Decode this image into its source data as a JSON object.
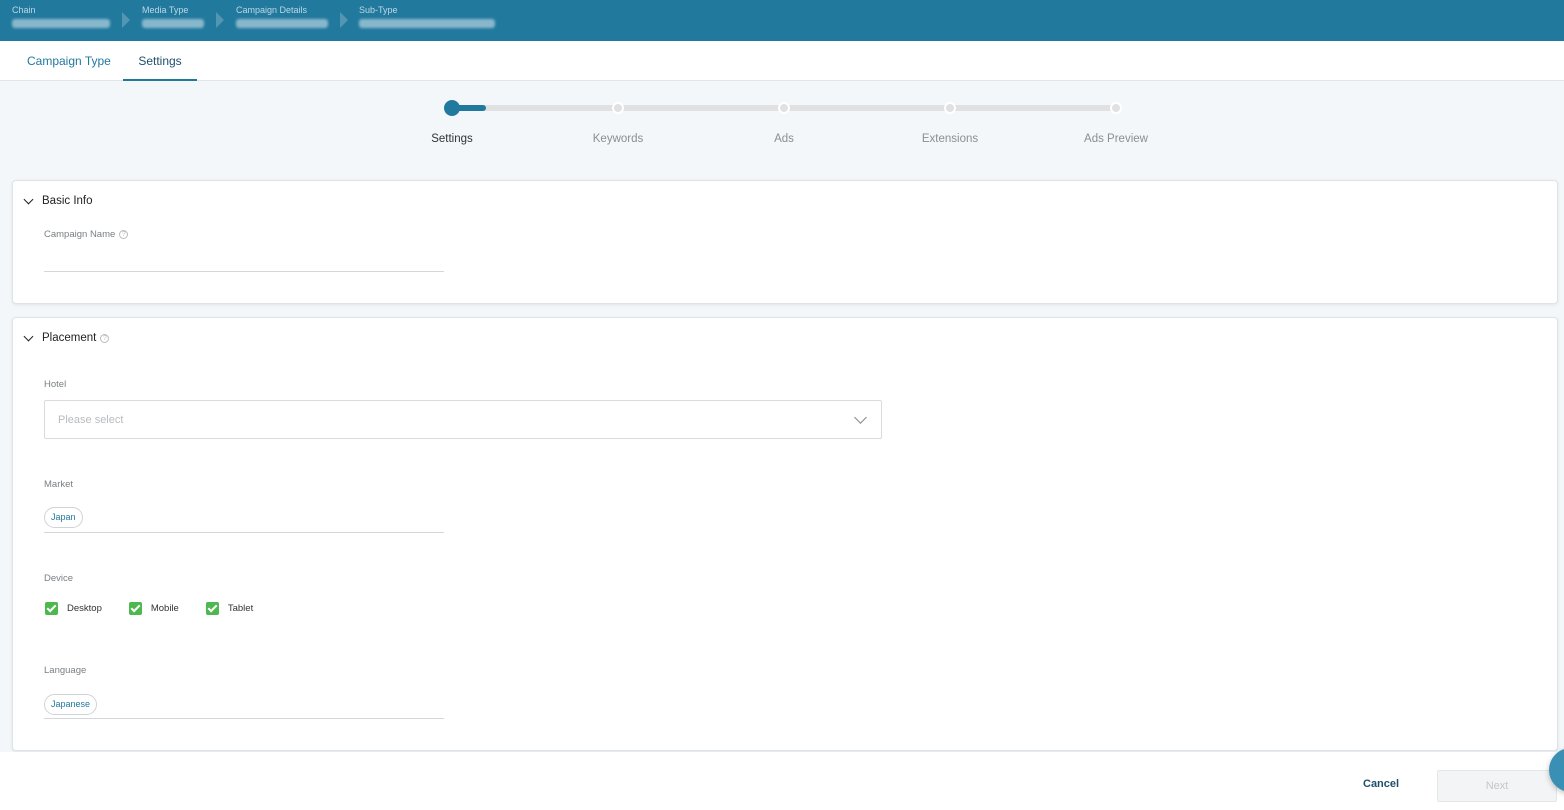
{
  "breadcrumb": [
    {
      "label": "Chain"
    },
    {
      "label": "Media Type"
    },
    {
      "label": "Campaign Details"
    },
    {
      "label": "Sub-Type"
    }
  ],
  "tabs": [
    {
      "label": "Campaign Type",
      "active": false
    },
    {
      "label": "Settings",
      "active": true
    }
  ],
  "stepper": {
    "steps": [
      "Settings",
      "Keywords",
      "Ads",
      "Extensions",
      "Ads Preview"
    ],
    "current_step": 1
  },
  "basic_info": {
    "title": "Basic Info",
    "campaign_name_label": "Campaign Name",
    "campaign_name_value": ""
  },
  "placement": {
    "title": "Placement",
    "hotel_label": "Hotel",
    "hotel_placeholder": "Please select",
    "market_label": "Market",
    "market_chips": [
      "Japan"
    ],
    "device_label": "Device",
    "devices": [
      {
        "label": "Desktop",
        "checked": true
      },
      {
        "label": "Mobile",
        "checked": true
      },
      {
        "label": "Tablet",
        "checked": true
      }
    ],
    "language_label": "Language",
    "language_chips": [
      "Japanese"
    ]
  },
  "footer": {
    "cancel_label": "Cancel",
    "next_label": "Next"
  },
  "colors": {
    "primary": "#22799e",
    "check": "#4cb84f"
  }
}
